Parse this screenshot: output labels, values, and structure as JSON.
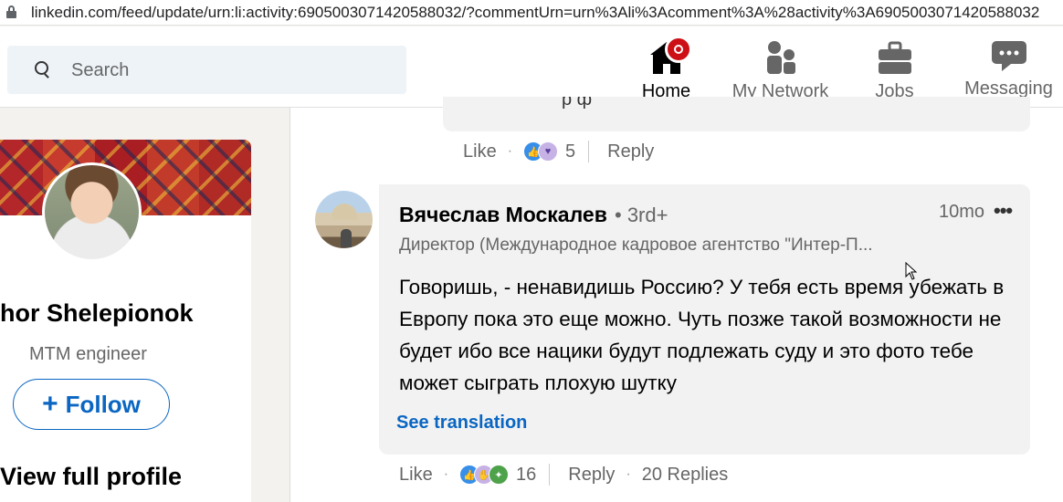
{
  "browser": {
    "url": "linkedin.com/feed/update/urn:li:activity:6905003071420588032/?commentUrn=urn%3Ali%3Acomment%3A%28activity%3A6905003071420588032"
  },
  "search": {
    "placeholder": "Search"
  },
  "nav": {
    "home": "Home",
    "network": "My Network",
    "jobs": "Jobs",
    "messaging": "Messaging"
  },
  "profile": {
    "name": "hor Shelepionok",
    "title": "MTM engineer",
    "follow": "Follow",
    "view_full": "View full profile"
  },
  "previous_comment": {
    "text_fragment": "р ф",
    "like": "Like",
    "reaction_count": "5",
    "reply": "Reply"
  },
  "comment": {
    "author": "Вячеслав Москалев",
    "degree": "• 3rd+",
    "time": "10mo",
    "more": "•••",
    "headline": "Директор (Международное кадровое агентство \"Интер-П...",
    "text": "Говоришь, - ненавидишь Россию? У тебя есть время убежать в Европу пока это еще можно. Чуть позже такой возможности не будет ибо все нацики будут подлежать суду и это фото тебе может сыграть плохую шутку",
    "see_translation": "See translation",
    "like": "Like",
    "reaction_count": "16",
    "reply": "Reply",
    "replies": "20 Replies"
  },
  "icons": {
    "home": "home-icon",
    "network": "people-icon",
    "jobs": "briefcase-icon",
    "messaging": "chat-icon",
    "search": "search-icon",
    "lock": "lock-icon",
    "reaction_like": "like-reaction-icon",
    "reaction_love": "love-reaction-icon",
    "reaction_support": "support-reaction-icon",
    "reaction_insight": "insightful-reaction-icon"
  },
  "colors": {
    "brand_blue": "#0a66c2",
    "notification_red": "#cc1016",
    "bubble_bg": "#f2f2f2",
    "page_bg": "#f3f2ef"
  }
}
